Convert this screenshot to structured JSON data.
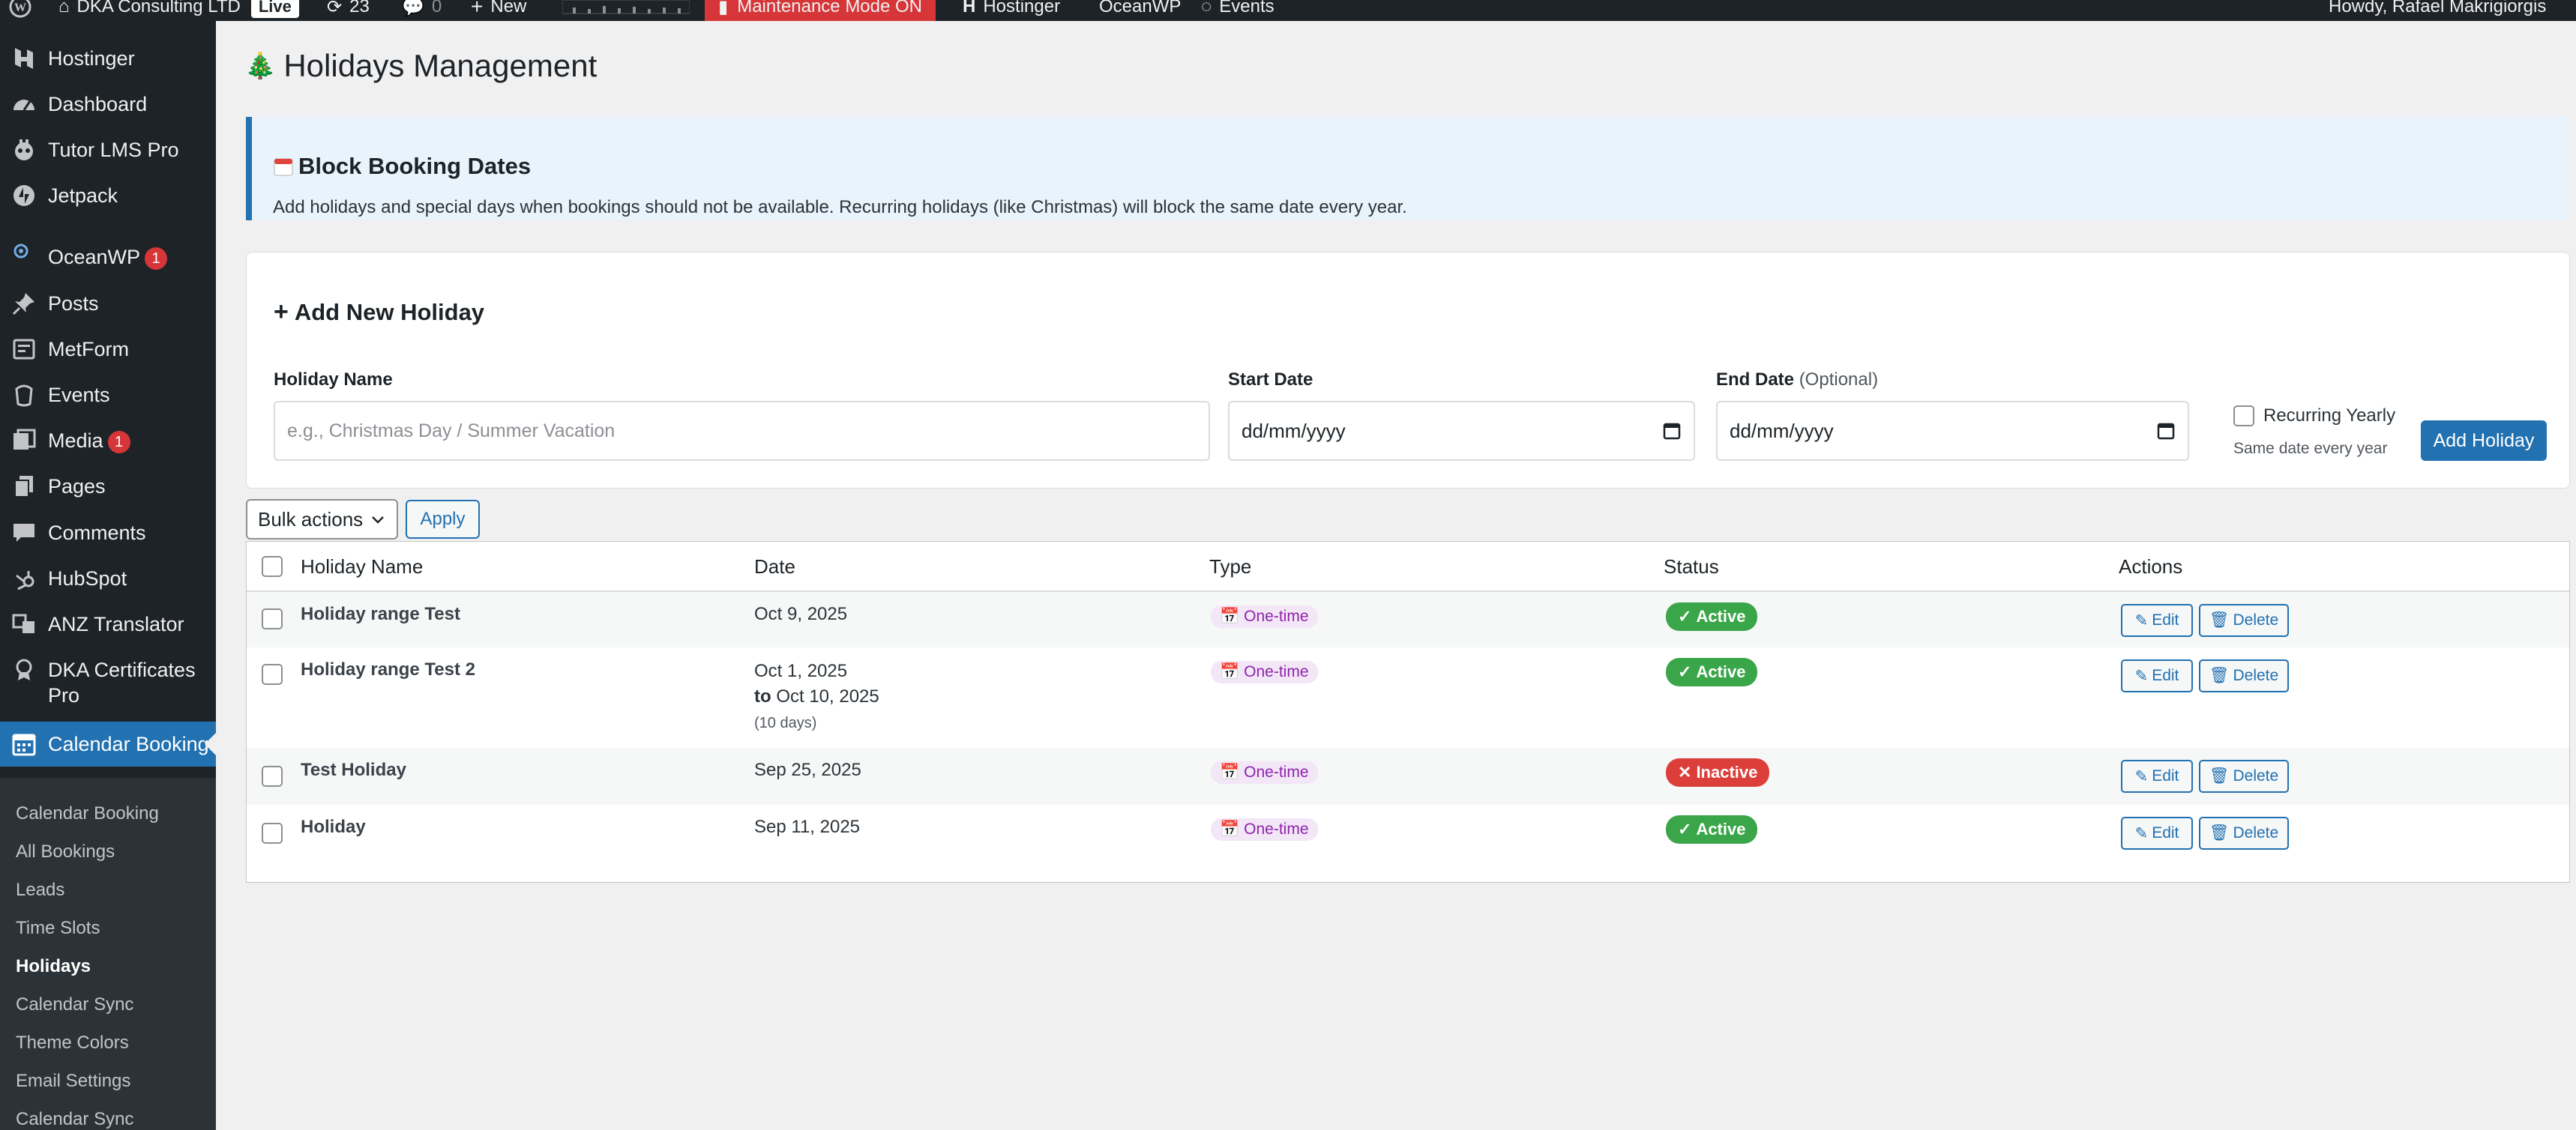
{
  "admin_bar": {
    "site_name": "DKA Consulting LTD",
    "live_badge": "Live",
    "updates_count": "23",
    "comments_count": "0",
    "new_label": "New",
    "maintenance_label": "Maintenance Mode ON",
    "hostinger_label": "Hostinger",
    "oceanwp_label": "OceanWP",
    "events_label": "Events",
    "howdy": "Howdy, Rafael Makrigiorgis"
  },
  "sidebar": {
    "items": [
      {
        "label": "Hostinger",
        "icon": "hostinger-icon"
      },
      {
        "label": "Dashboard",
        "icon": "dashboard-icon"
      },
      {
        "label": "Tutor LMS Pro",
        "icon": "tutor-icon"
      },
      {
        "label": "Jetpack",
        "icon": "jetpack-icon"
      },
      {
        "label": "OceanWP",
        "icon": "oceanwp-icon",
        "badge": "1"
      },
      {
        "label": "Posts",
        "icon": "pin-icon"
      },
      {
        "label": "MetForm",
        "icon": "form-icon"
      },
      {
        "label": "Events",
        "icon": "events-icon"
      },
      {
        "label": "Media",
        "icon": "media-icon",
        "badge": "1"
      },
      {
        "label": "Pages",
        "icon": "pages-icon"
      },
      {
        "label": "Comments",
        "icon": "comments-icon"
      },
      {
        "label": "HubSpot",
        "icon": "hubspot-icon"
      },
      {
        "label": "ANZ Translator",
        "icon": "translate-icon"
      },
      {
        "label": "DKA Certificates Pro",
        "icon": "certificate-icon"
      },
      {
        "label": "Calendar Booking",
        "icon": "calendar-icon"
      }
    ],
    "submenu": [
      "Calendar Booking",
      "All Bookings",
      "Leads",
      "Time Slots",
      "Holidays",
      "Calendar Sync",
      "Theme Colors",
      "Email Settings",
      "Calendar Sync"
    ]
  },
  "page": {
    "title": "Holidays Management",
    "title_emoji": "🎄"
  },
  "notice": {
    "title": "Block Booking Dates",
    "text": "Add holidays and special days when bookings should not be available. Recurring holidays (like Christmas) will block the same date every year."
  },
  "add_form": {
    "heading": "Add New Holiday",
    "name_label": "Holiday Name",
    "name_placeholder": "e.g., Christmas Day / Summer Vacation",
    "start_label": "Start Date",
    "start_value": "dd/mm/yyyy",
    "end_label": "End Date",
    "end_optional": "(Optional)",
    "end_value": "dd/mm/yyyy",
    "recurring_label": "Recurring Yearly",
    "recurring_hint": "Same date every year",
    "submit_label": "Add Holiday"
  },
  "bulk": {
    "select_label": "Bulk actions",
    "apply_label": "Apply"
  },
  "table": {
    "headers": [
      "Holiday Name",
      "Date",
      "Type",
      "Status",
      "Actions"
    ],
    "rows": [
      {
        "name": "Holiday range Test",
        "date": "Oct 9, 2025",
        "type": "One-time",
        "status": "Active",
        "edit": "Edit",
        "delete": "Delete"
      },
      {
        "name": "Holiday range Test 2",
        "date": "Oct 1, 2025",
        "to_word": "to",
        "date_end": "Oct 10, 2025",
        "days": "(10 days)",
        "type": "One-time",
        "status": "Active",
        "edit": "Edit",
        "delete": "Delete"
      },
      {
        "name": "Test Holiday",
        "date": "Sep 25, 2025",
        "type": "One-time",
        "status": "Inactive",
        "edit": "Edit",
        "delete": "Delete"
      },
      {
        "name": "Holiday",
        "date": "Sep 11, 2025",
        "type": "One-time",
        "status": "Active",
        "edit": "Edit",
        "delete": "Delete"
      }
    ]
  },
  "colors": {
    "admin_dark": "#1d2327",
    "accent_blue": "#2271b1",
    "active_green": "#3aa649",
    "inactive_red": "#dc3e3a",
    "type_purple": "#8e24aa",
    "notice_bg": "#e8f3fc"
  }
}
